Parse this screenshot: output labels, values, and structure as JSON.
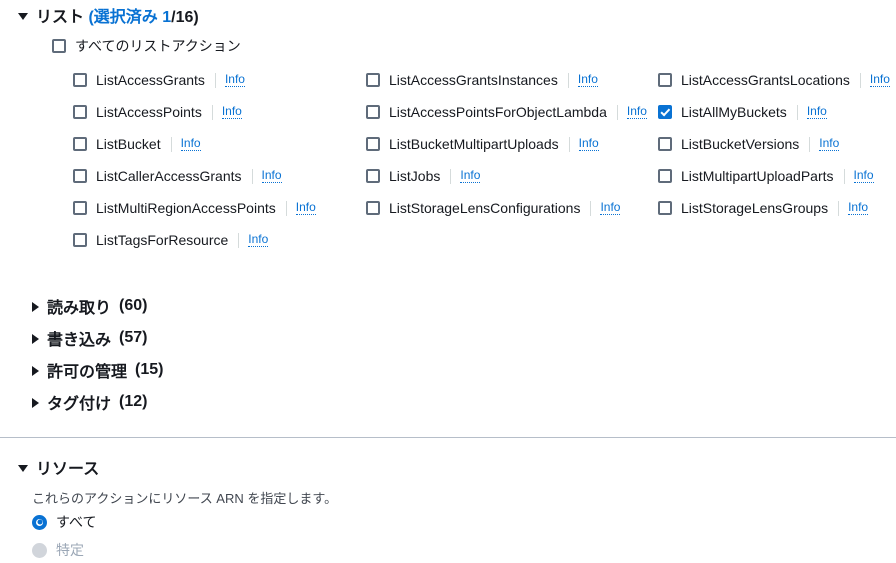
{
  "list_group": {
    "caret": "caret-down-icon",
    "title": "リスト",
    "open_paren": "(",
    "selected_label": "選択済み 1",
    "total_label": "/16)",
    "select_all_label": "すべてのリストアクション",
    "info_label": "Info",
    "columns": [
      [
        {
          "label": "ListAccessGrants",
          "checked": false,
          "info": "Info"
        },
        {
          "label": "ListAccessPoints",
          "checked": false,
          "info": "Info"
        },
        {
          "label": "ListBucket",
          "checked": false,
          "info": "Info"
        },
        {
          "label": "ListCallerAccessGrants",
          "checked": false,
          "info": "Info"
        },
        {
          "label": "ListMultiRegionAccessPoints",
          "checked": false,
          "info": "Info"
        },
        {
          "label": "ListTagsForResource",
          "checked": false,
          "info": "Info"
        }
      ],
      [
        {
          "label": "ListAccessGrantsInstances",
          "checked": false,
          "info": "Info"
        },
        {
          "label": "ListAccessPointsForObjectLambda",
          "checked": false,
          "info": "Info"
        },
        {
          "label": "ListBucketMultipartUploads",
          "checked": false,
          "info": "Info"
        },
        {
          "label": "ListJobs",
          "checked": false,
          "info": "Info"
        },
        {
          "label": "ListStorageLensConfigurations",
          "checked": false,
          "info": "Info"
        }
      ],
      [
        {
          "label": "ListAccessGrantsLocations",
          "checked": false,
          "info": "Info"
        },
        {
          "label": "ListAllMyBuckets",
          "checked": true,
          "info": "Info"
        },
        {
          "label": "ListBucketVersions",
          "checked": false,
          "info": "Info"
        },
        {
          "label": "ListMultipartUploadParts",
          "checked": false,
          "info": "Info"
        },
        {
          "label": "ListStorageLensGroups",
          "checked": false,
          "info": "Info"
        }
      ]
    ]
  },
  "collapsed_groups": [
    {
      "title": "読み取り",
      "count": "(60)"
    },
    {
      "title": "書き込み",
      "count": "(57)"
    },
    {
      "title": "許可の管理",
      "count": "(15)"
    },
    {
      "title": "タグ付け",
      "count": "(12)"
    }
  ],
  "resources": {
    "title": "リソース",
    "description": "これらのアクションにリソース ARN を指定します。",
    "options": [
      {
        "label": "すべて",
        "selected": true,
        "disabled": false
      },
      {
        "label": "特定",
        "selected": false,
        "disabled": true
      }
    ]
  },
  "colors": {
    "accent": "#0972d3",
    "text": "#16191f",
    "muted": "#414750",
    "disabled": "#9ba7b6",
    "divider": "#b6bec9",
    "checkbox_border": "#5f6b7a"
  }
}
